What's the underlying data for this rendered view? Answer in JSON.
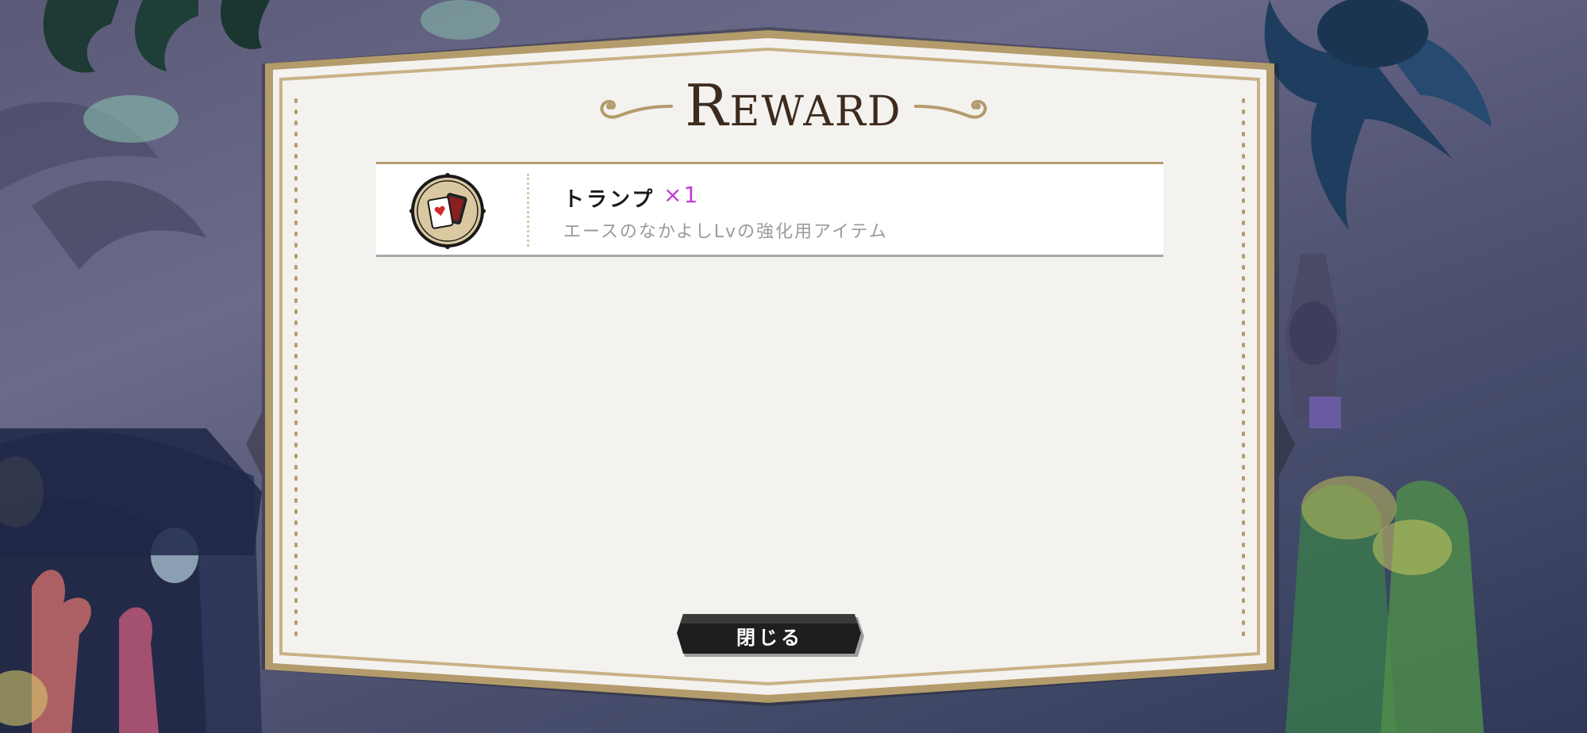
{
  "dialog": {
    "title": "REWARD",
    "title_cap": "R",
    "title_rest": "EWARD"
  },
  "rewards": [
    {
      "name": "トランプ",
      "quantity": "×1",
      "description": "エースのなかよしLvの強化用アイテム",
      "icon": "playing-cards-icon"
    }
  ],
  "buttons": {
    "close_label": "閉じる"
  },
  "colors": {
    "panel_bg": "#f4f2ef",
    "panel_border": "#b39b6c",
    "title_text": "#3d2b1e",
    "quantity_accent": "#c23bd4",
    "description_text": "#9a9a9a",
    "button_bg": "#1e1e1e"
  }
}
